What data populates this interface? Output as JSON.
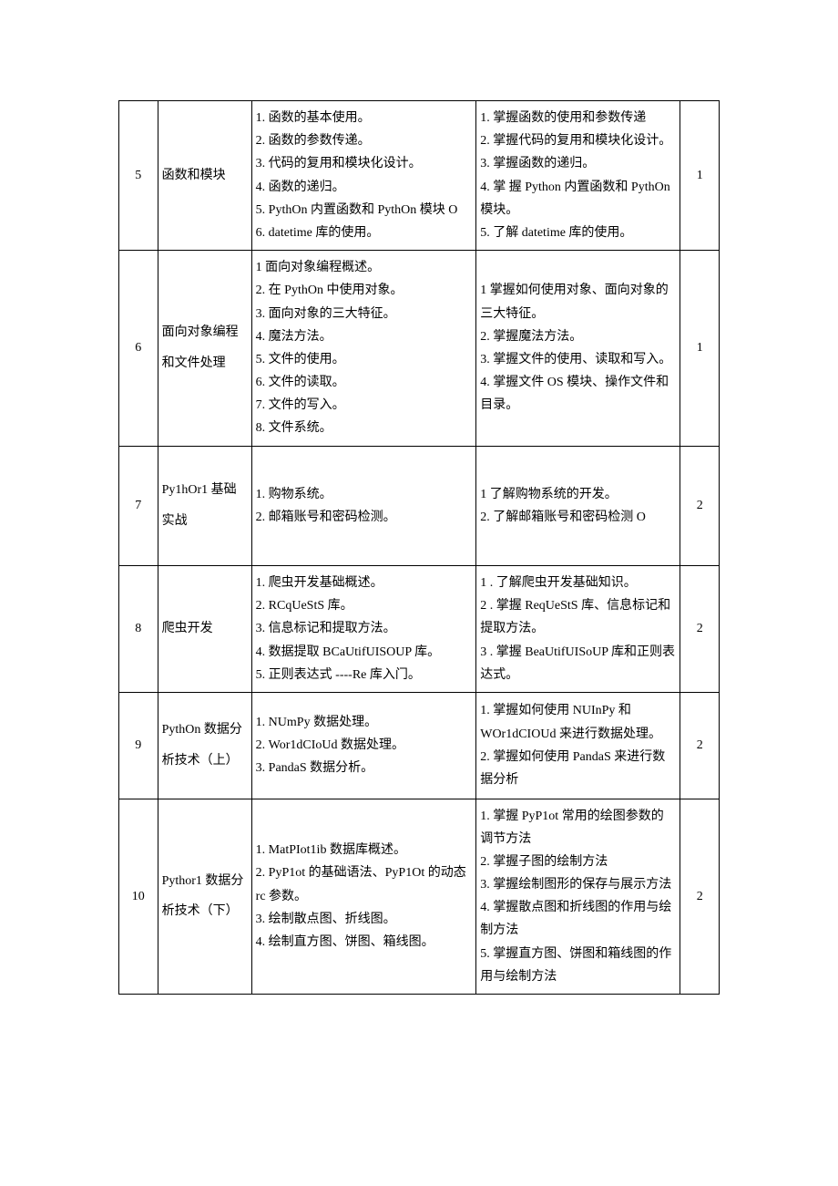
{
  "rows": [
    {
      "num": "5",
      "title": "函数和模块",
      "content": "1. 函数的基本使用。\n2. 函数的参数传递。\n3. 代码的复用和模块化设计。\n4. 函数的递归。\n5. PythOn 内置函数和 PythOn 模块 O\n6. datetime 库的使用。",
      "goals": "1. 掌握函数的使用和参数传递\n2. 掌握代码的复用和模块化设计。\n3. 掌握函数的递归。\n4. 掌 握 Python 内置函数和 PythOn 模块。\n5. 了解 datetime 库的使用。",
      "last": "1"
    },
    {
      "num": "6",
      "title": "面向对象编程和文件处理",
      "content": "1 面向对象编程概述。\n2. 在 PythOn 中使用对象。\n3. 面向对象的三大特征。\n4. 魔法方法。\n5. 文件的使用。\n6. 文件的读取。\n7. 文件的写入。\n8. 文件系统。",
      "goals": "1 掌握如何使用对象、面向对象的三大特征。\n2. 掌握魔法方法。\n3. 掌握文件的使用、读取和写入。\n4. 掌握文件 OS 模块、操作文件和目录。",
      "last": "1"
    },
    {
      "num": "7",
      "title": "Py1hOr1 基础实战",
      "content": "1. 购物系统。\n2. 邮箱账号和密码检测。",
      "goals": "1 了解购物系统的开发。\n2. 了解邮箱账号和密码检测 O",
      "last": "2"
    },
    {
      "num": "8",
      "title": "爬虫开发",
      "content": "1. 爬虫开发基础概述。\n2. RCqUeStS 库。\n3. 信息标记和提取方法。\n4. 数据提取 BCaUtifUISOUP 库。\n5. 正则表达式 ----Re 库入门。",
      "goals": "1         . 了解爬虫开发基础知识。\n2         . 掌握 ReqUeStS 库、信息标记和提取方法。\n3         . 掌握 BeaUtifUISoUP 库和正则表达式。",
      "last": "2"
    },
    {
      "num": "9",
      "title": "PythOn 数据分析技术（上）",
      "content": "1. NUmPy 数据处理。\n2. Wor1dCIoUd 数据处理。\n3. PandaS 数据分析。",
      "goals": "1. 掌握如何使用 NUInPy 和 WOr1dCIOUd 来进行数据处理。\n2. 掌握如何使用 PandaS 来进行数据分析",
      "last": "2"
    },
    {
      "num": "10",
      "title": "Pythor1 数据分析技术（下）",
      "content": "1. MatPIot1ib 数据库概述。\n2. PyP1ot 的基础语法、PyP1Ot 的动态 rc 参数。\n3. 绘制散点图、折线图。\n4. 绘制直方图、饼图、箱线图。",
      "goals": "1. 掌握 PyP1ot 常用的绘图参数的调节方法\n2. 掌握子图的绘制方法\n3. 掌握绘制图形的保存与展示方法\n4. 掌握散点图和折线图的作用与绘制方法\n5. 掌握直方图、饼图和箱线图的作用与绘制方法",
      "last": "2"
    }
  ]
}
